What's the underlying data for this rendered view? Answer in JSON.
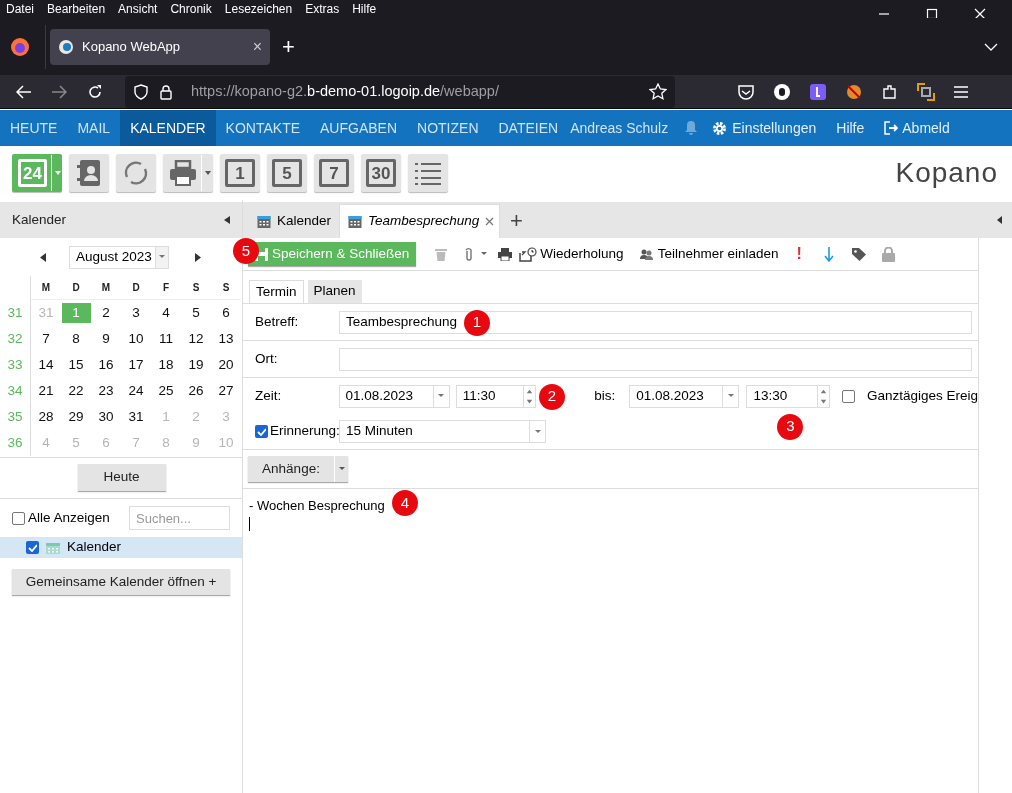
{
  "browser": {
    "menu": [
      "Datei",
      "Bearbeiten",
      "Ansicht",
      "Chronik",
      "Lesezeichen",
      "Extras",
      "Hilfe"
    ],
    "tab": {
      "title": "Kopano WebApp",
      "close": "×",
      "new": "+"
    },
    "url": {
      "prefix": "https://kopano-g2.",
      "domain": "b-demo-01.logoip.de",
      "path": "/webapp/"
    }
  },
  "app_nav": {
    "items": [
      {
        "label": "HEUTE",
        "selected": false
      },
      {
        "label": "MAIL",
        "selected": false
      },
      {
        "label": "KALENDER",
        "selected": true
      },
      {
        "label": "KONTAKTE",
        "selected": false
      },
      {
        "label": "AUFGABEN",
        "selected": false
      },
      {
        "label": "NOTIZEN",
        "selected": false
      },
      {
        "label": "DATEIEN",
        "selected": false
      }
    ],
    "user": "Andreas Schulz",
    "settings": "Einstellungen",
    "help": "Hilfe",
    "logout": "Abmeld"
  },
  "toolbar": [
    {
      "kind": "new",
      "label": "24",
      "selected": true
    },
    {
      "kind": "contacts",
      "selected": false
    },
    {
      "kind": "sync",
      "selected": false
    },
    {
      "kind": "print",
      "selected": false
    },
    {
      "kind": "day",
      "label": "1",
      "selected": false
    },
    {
      "kind": "day",
      "label": "5",
      "selected": false
    },
    {
      "kind": "day",
      "label": "7",
      "selected": false
    },
    {
      "kind": "day",
      "label": "30",
      "selected": false
    },
    {
      "kind": "list",
      "selected": false
    }
  ],
  "logo": "Kopano",
  "sidebar": {
    "title": "Kalender",
    "month": "August 2023",
    "weekdays": [
      "M",
      "D",
      "M",
      "D",
      "F",
      "S",
      "S"
    ],
    "weeks": [
      {
        "number": "31",
        "days": [
          {
            "day": "31",
            "outside": true,
            "selected": false
          },
          {
            "day": "1",
            "outside": false,
            "selected": true
          },
          {
            "day": "2",
            "outside": false,
            "selected": false
          },
          {
            "day": "3",
            "outside": false,
            "selected": false
          },
          {
            "day": "4",
            "outside": false,
            "selected": false
          },
          {
            "day": "5",
            "outside": false,
            "selected": false
          },
          {
            "day": "6",
            "outside": false,
            "selected": false
          }
        ]
      },
      {
        "number": "32",
        "days": [
          {
            "day": "7",
            "outside": false,
            "selected": false
          },
          {
            "day": "8",
            "outside": false,
            "selected": false
          },
          {
            "day": "9",
            "outside": false,
            "selected": false
          },
          {
            "day": "10",
            "outside": false,
            "selected": false
          },
          {
            "day": "11",
            "outside": false,
            "selected": false
          },
          {
            "day": "12",
            "outside": false,
            "selected": false
          },
          {
            "day": "13",
            "outside": false,
            "selected": false
          }
        ]
      },
      {
        "number": "33",
        "days": [
          {
            "day": "14",
            "outside": false,
            "selected": false
          },
          {
            "day": "15",
            "outside": false,
            "selected": false
          },
          {
            "day": "16",
            "outside": false,
            "selected": false
          },
          {
            "day": "17",
            "outside": false,
            "selected": false
          },
          {
            "day": "18",
            "outside": false,
            "selected": false
          },
          {
            "day": "19",
            "outside": false,
            "selected": false
          },
          {
            "day": "20",
            "outside": false,
            "selected": false
          }
        ]
      },
      {
        "number": "34",
        "days": [
          {
            "day": "21",
            "outside": false,
            "selected": false
          },
          {
            "day": "22",
            "outside": false,
            "selected": false
          },
          {
            "day": "23",
            "outside": false,
            "selected": false
          },
          {
            "day": "24",
            "outside": false,
            "selected": false
          },
          {
            "day": "25",
            "outside": false,
            "selected": false
          },
          {
            "day": "26",
            "outside": false,
            "selected": false
          },
          {
            "day": "27",
            "outside": false,
            "selected": false
          }
        ]
      },
      {
        "number": "35",
        "days": [
          {
            "day": "28",
            "outside": false,
            "selected": false
          },
          {
            "day": "29",
            "outside": false,
            "selected": false
          },
          {
            "day": "30",
            "outside": false,
            "selected": false
          },
          {
            "day": "31",
            "outside": false,
            "selected": false
          },
          {
            "day": "1",
            "outside": true,
            "selected": false
          },
          {
            "day": "2",
            "outside": true,
            "selected": false
          },
          {
            "day": "3",
            "outside": true,
            "selected": false
          }
        ]
      },
      {
        "number": "36",
        "days": [
          {
            "day": "4",
            "outside": true,
            "selected": false
          },
          {
            "day": "5",
            "outside": true,
            "selected": false
          },
          {
            "day": "6",
            "outside": true,
            "selected": false
          },
          {
            "day": "7",
            "outside": true,
            "selected": false
          },
          {
            "day": "8",
            "outside": true,
            "selected": false
          },
          {
            "day": "9",
            "outside": true,
            "selected": false
          },
          {
            "day": "10",
            "outside": true,
            "selected": false
          }
        ]
      }
    ],
    "today_button": "Heute",
    "show_all": {
      "label": "Alle Anzeigen",
      "checked": false
    },
    "search": {
      "placeholder": "Suchen..."
    },
    "calendars": [
      {
        "label": "Kalender",
        "checked": true,
        "selected": true
      }
    ],
    "shared_button": "Gemeinsame Kalender öffnen +"
  },
  "tabs": [
    {
      "label": "Kalender",
      "selected": false,
      "closable": false
    },
    {
      "label": "Teambesprechung",
      "selected": true,
      "closable": true
    }
  ],
  "tab_add": "+",
  "form": {
    "save": {
      "label": "Speichern & Schließen",
      "marker": "5"
    },
    "recurrence": "Wiederholung",
    "invite": "Teilnehmer einladen",
    "priority": "!",
    "subtabs": [
      {
        "label": "Termin",
        "selected": true
      },
      {
        "label": "Planen",
        "selected": false
      }
    ],
    "subject": {
      "label": "Betreff:",
      "value": "Teambesprechung",
      "marker": "1"
    },
    "location": {
      "label": "Ort:"
    },
    "time": {
      "label": "Zeit:",
      "start_date": "01.08.2023",
      "start_time": "11:30",
      "start_marker": "2",
      "until": "bis:",
      "end_date": "01.08.2023",
      "end_time": "13:30",
      "end_marker": "3",
      "all_day": {
        "label": "Ganztägiges Ereig",
        "checked": false
      }
    },
    "reminder": {
      "label": "Erinnerung:",
      "checked": true,
      "value": "15 Minuten"
    },
    "attachments": "Anhänge:",
    "body": {
      "text": "- Wochen Besprechung",
      "marker": "4"
    }
  }
}
